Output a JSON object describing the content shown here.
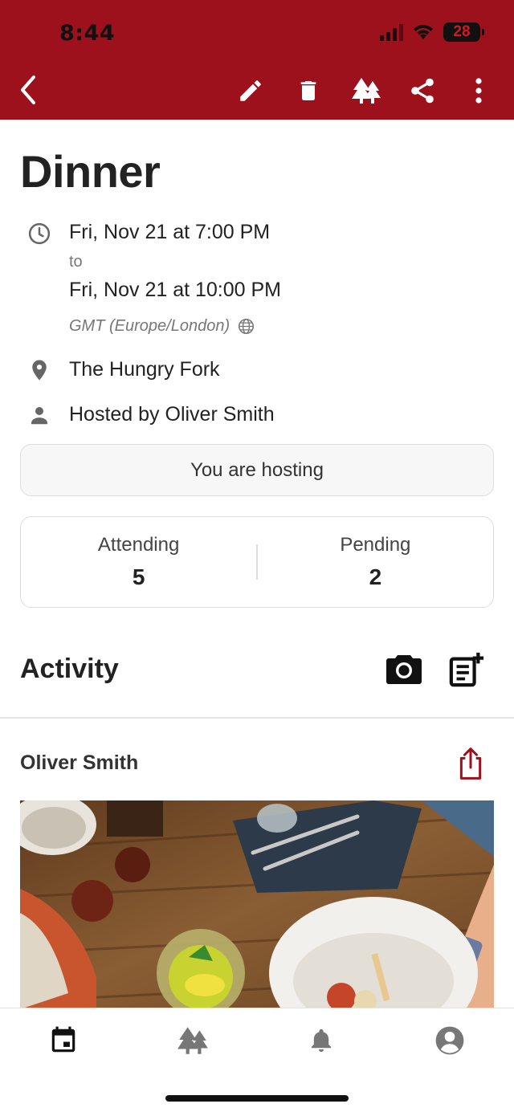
{
  "status_bar": {
    "time": "8:44",
    "battery": "28"
  },
  "toolbar": {
    "back_icon": "chevron-left-icon",
    "edit_icon": "pencil-icon",
    "delete_icon": "trash-icon",
    "trees_icon": "trees-icon",
    "share_icon": "share-icon",
    "more_icon": "more-vertical-icon"
  },
  "event": {
    "title": "Dinner",
    "start": "Fri, Nov 21 at 7:00 PM",
    "to_label": "to",
    "end": "Fri, Nov 21 at 10:00 PM",
    "timezone": "GMT (Europe/London)",
    "location": "The Hungry Fork",
    "host": "Hosted by Oliver Smith",
    "hosting_status": "You are hosting"
  },
  "stats": {
    "attending_label": "Attending",
    "attending_value": "5",
    "pending_label": "Pending",
    "pending_value": "2"
  },
  "activity": {
    "title": "Activity",
    "camera_icon": "camera-icon",
    "add_post_icon": "add-post-icon"
  },
  "post": {
    "author": "Oliver Smith",
    "share_icon": "share-upload-icon"
  },
  "bottom_tabs": [
    {
      "name": "calendar",
      "icon": "calendar-icon",
      "active": true
    },
    {
      "name": "groups",
      "icon": "trees-icon",
      "active": false
    },
    {
      "name": "notifications",
      "icon": "bell-icon",
      "active": false
    },
    {
      "name": "profile",
      "icon": "profile-icon",
      "active": false
    }
  ],
  "colors": {
    "brand": "#9c111c",
    "active_tab": "#111111",
    "inactive_tab": "#777777"
  }
}
